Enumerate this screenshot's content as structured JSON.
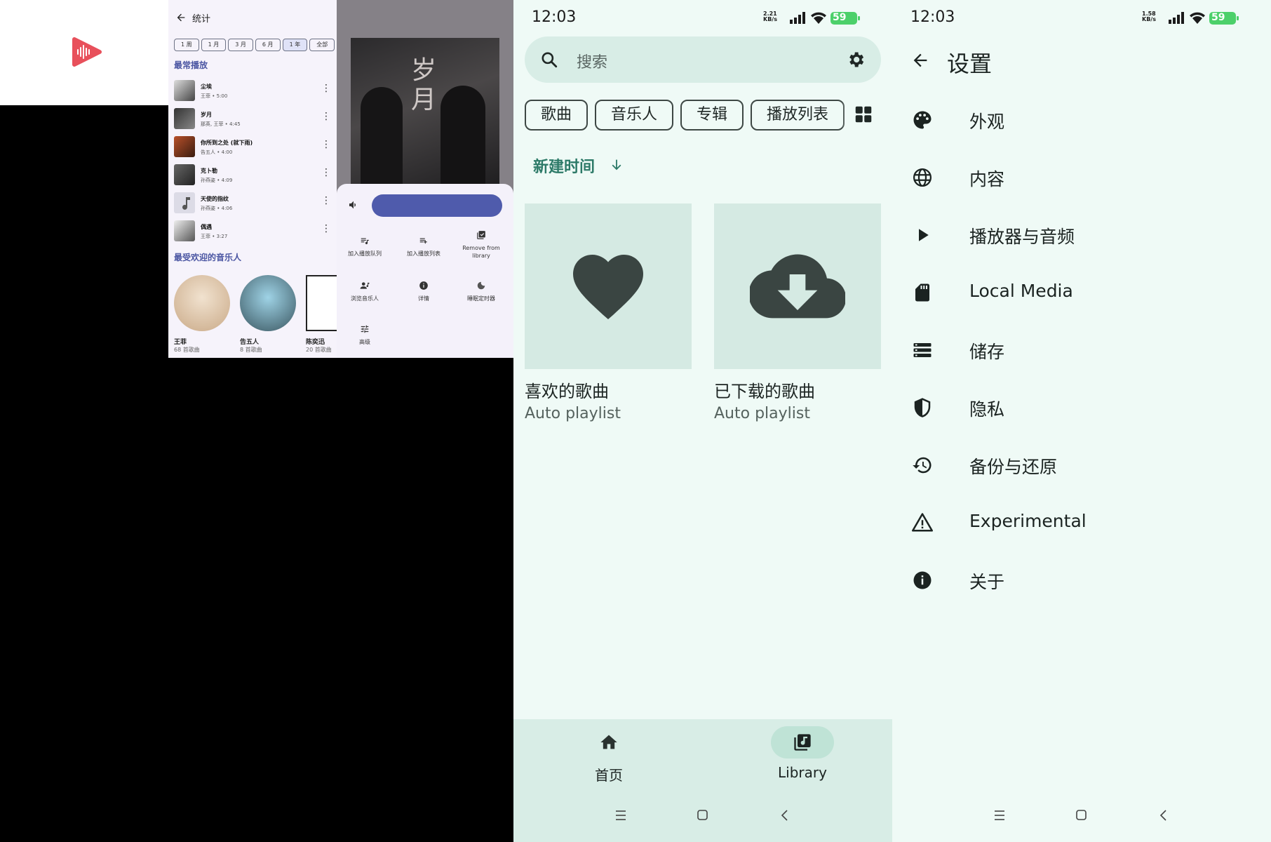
{
  "stats": {
    "title": "统计",
    "periods": [
      "1 周",
      "1 月",
      "3 月",
      "6 月",
      "1 年",
      "全部"
    ],
    "most_played_title": "最常播放",
    "songs": [
      {
        "title": "尘埃",
        "meta": "王菲 • 5:00"
      },
      {
        "title": "岁月",
        "meta": "那英, 王菲 • 4:45"
      },
      {
        "title": "你所到之处 (就下雨)",
        "meta": "告五人 • 4:00"
      },
      {
        "title": "克卜勒",
        "meta": "孙燕姿 • 4:09"
      },
      {
        "title": "天使的指纹",
        "meta": "孙燕姿 • 4:06"
      },
      {
        "title": "偶遇",
        "meta": "王菲 • 3:27"
      }
    ],
    "artists_title": "最受欢迎的音乐人",
    "artists": [
      {
        "name": "王菲",
        "count": "68 首歌曲"
      },
      {
        "name": "告五人",
        "count": "8 首歌曲"
      },
      {
        "name": "陈奕迅",
        "count": "20 首歌曲"
      }
    ]
  },
  "player": {
    "cover_text": "岁月",
    "actions": [
      {
        "label": "加入播放队列",
        "icon": "queue-add-icon"
      },
      {
        "label": "加入播放列表",
        "icon": "playlist-add-icon"
      },
      {
        "label": "Remove from library",
        "icon": "library-check-icon"
      },
      {
        "label": "浏览音乐人",
        "icon": "artist-icon"
      },
      {
        "label": "详情",
        "icon": "info-icon"
      },
      {
        "label": "睡眠定时器",
        "icon": "moon-icon"
      },
      {
        "label": "高级",
        "icon": "tune-icon"
      }
    ]
  },
  "library": {
    "time": "12:03",
    "net_speed": "2.21 KB/s",
    "battery": "59",
    "search_placeholder": "搜索",
    "tabs": [
      "歌曲",
      "音乐人",
      "专辑",
      "播放列表"
    ],
    "sort_label": "新建时间",
    "cards": [
      {
        "title": "喜欢的歌曲",
        "subtitle": "Auto playlist",
        "icon": "heart-icon"
      },
      {
        "title": "已下载的歌曲",
        "subtitle": "Auto playlist",
        "icon": "cloud-download-icon"
      }
    ],
    "nav": [
      {
        "label": "首页",
        "icon": "home-icon"
      },
      {
        "label": "Library",
        "icon": "library-music-icon"
      }
    ]
  },
  "settings": {
    "time": "12:03",
    "net_speed": "1.58 KB/s",
    "battery": "59",
    "title": "设置",
    "items": [
      {
        "label": "外观",
        "icon": "palette-icon"
      },
      {
        "label": "内容",
        "icon": "globe-icon"
      },
      {
        "label": "播放器与音频",
        "icon": "play-icon"
      },
      {
        "label": "Local Media",
        "icon": "sd-card-icon"
      },
      {
        "label": "储存",
        "icon": "storage-icon"
      },
      {
        "label": "隐私",
        "icon": "shield-icon"
      },
      {
        "label": "备份与还原",
        "icon": "restore-icon"
      },
      {
        "label": "Experimental",
        "icon": "warning-icon"
      },
      {
        "label": "关于",
        "icon": "info-icon"
      }
    ]
  },
  "colors": {
    "accent_stats": "#4a55a2",
    "volume_bar": "#4f5bac",
    "library_bg": "#effaf6",
    "library_accent": "#2d7a68",
    "logo_red": "#e8505b"
  }
}
